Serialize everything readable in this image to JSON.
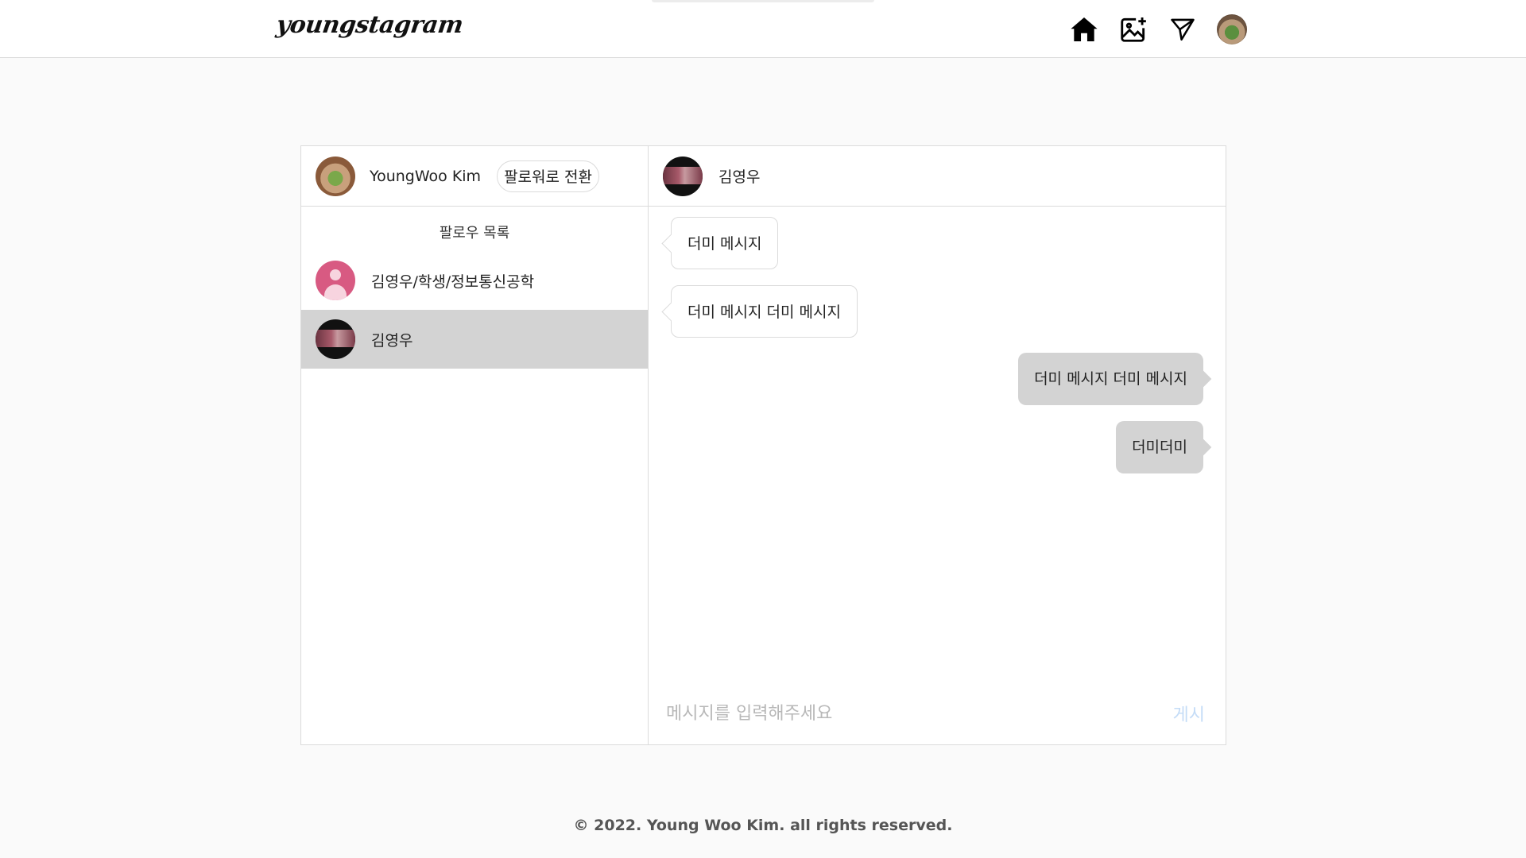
{
  "header": {
    "logo": "youngstagram",
    "nav": {
      "home_icon": "home-icon",
      "upload_icon": "add-photo-icon",
      "dm_icon": "send-icon",
      "profile_icon": "profile-avatar"
    }
  },
  "sidebar": {
    "me": {
      "name": "YoungWoo Kim",
      "switch_label": "팔로워로 전환"
    },
    "list_title": "팔로우 목록",
    "items": [
      {
        "name": "김영우/학생/정보통신공학",
        "selected": false
      },
      {
        "name": "김영우",
        "selected": true
      }
    ]
  },
  "chat": {
    "partner_name": "김영우",
    "messages": [
      {
        "direction": "in",
        "text": "더미 메시지"
      },
      {
        "direction": "in",
        "text": "더미 메시지 더미 메시지"
      },
      {
        "direction": "out",
        "text": "더미 메시지 더미 메시지"
      },
      {
        "direction": "out",
        "text": "더미더미"
      }
    ],
    "input_placeholder": "메시지를 입력해주세요",
    "post_label": "게시"
  },
  "footer": {
    "copyright": "© 2022. Young Woo Kim. all rights reserved."
  },
  "colors": {
    "selected_row": "#d3d3d3",
    "outgoing_bubble": "#d3d3d3",
    "post_button_disabled": "#c4dcf7"
  }
}
